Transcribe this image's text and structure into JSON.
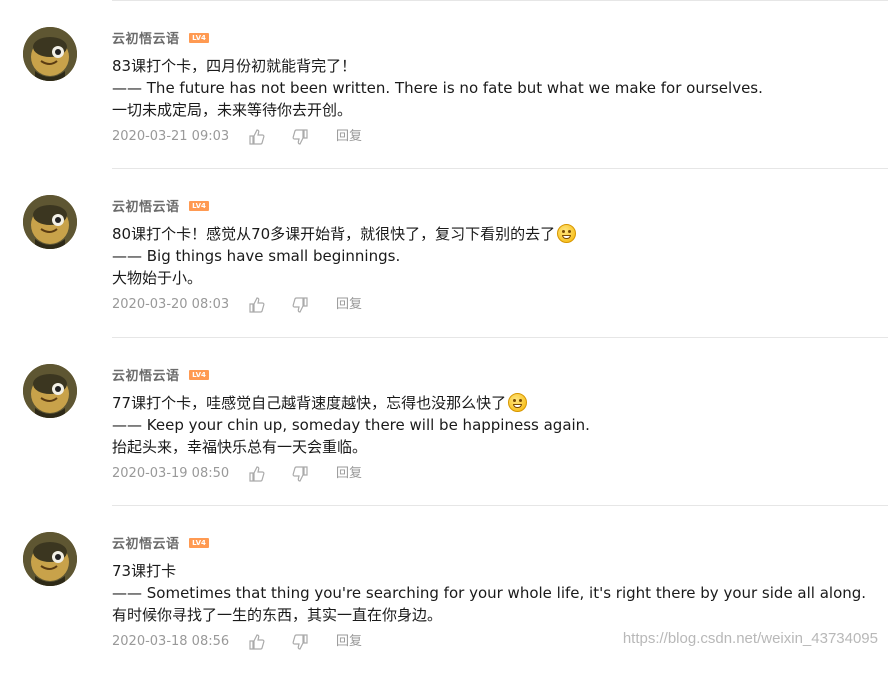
{
  "comments": [
    {
      "username": "云初悟云语",
      "badge": "LV4",
      "lines": [
        "83课打个卡，四月份初就能背完了！",
        "—— The future has not been written. There is no fate but what we make for ourselves.",
        "一切未成定局，未来等待你去开创。"
      ],
      "emoji": null,
      "time": "2020-03-21 09:03",
      "reply": "回复"
    },
    {
      "username": "云初悟云语",
      "badge": "LV4",
      "lines": [
        "80课打个卡！感觉从70多课开始背，就很快了，复习下看别的去了",
        "—— Big things have small beginnings.",
        "大物始于小。"
      ],
      "emoji": "drool-face",
      "time": "2020-03-20 08:03",
      "reply": "回复"
    },
    {
      "username": "云初悟云语",
      "badge": "LV4",
      "lines": [
        "77课打个卡，哇感觉自己越背速度越快，忘得也没那么快了",
        "—— Keep your chin up, someday there will be happiness again.",
        "抬起头来，幸福快乐总有一天会重临。"
      ],
      "emoji": "grin-face",
      "time": "2020-03-19 08:50",
      "reply": "回复"
    },
    {
      "username": "云初悟云语",
      "badge": "LV4",
      "lines": [
        "73课打卡",
        "—— Sometimes that thing you're searching for your whole life, it's right there by your side all along.",
        "有时候你寻找了一生的东西，其实一直在你身边。"
      ],
      "emoji": null,
      "time": "2020-03-18 08:56",
      "reply": "回复"
    }
  ],
  "watermark": "https://blog.csdn.net/weixin_43734095",
  "colors": {
    "badge": "#ff9a52",
    "meta": "#999999",
    "separator": "#e6e6e6"
  }
}
